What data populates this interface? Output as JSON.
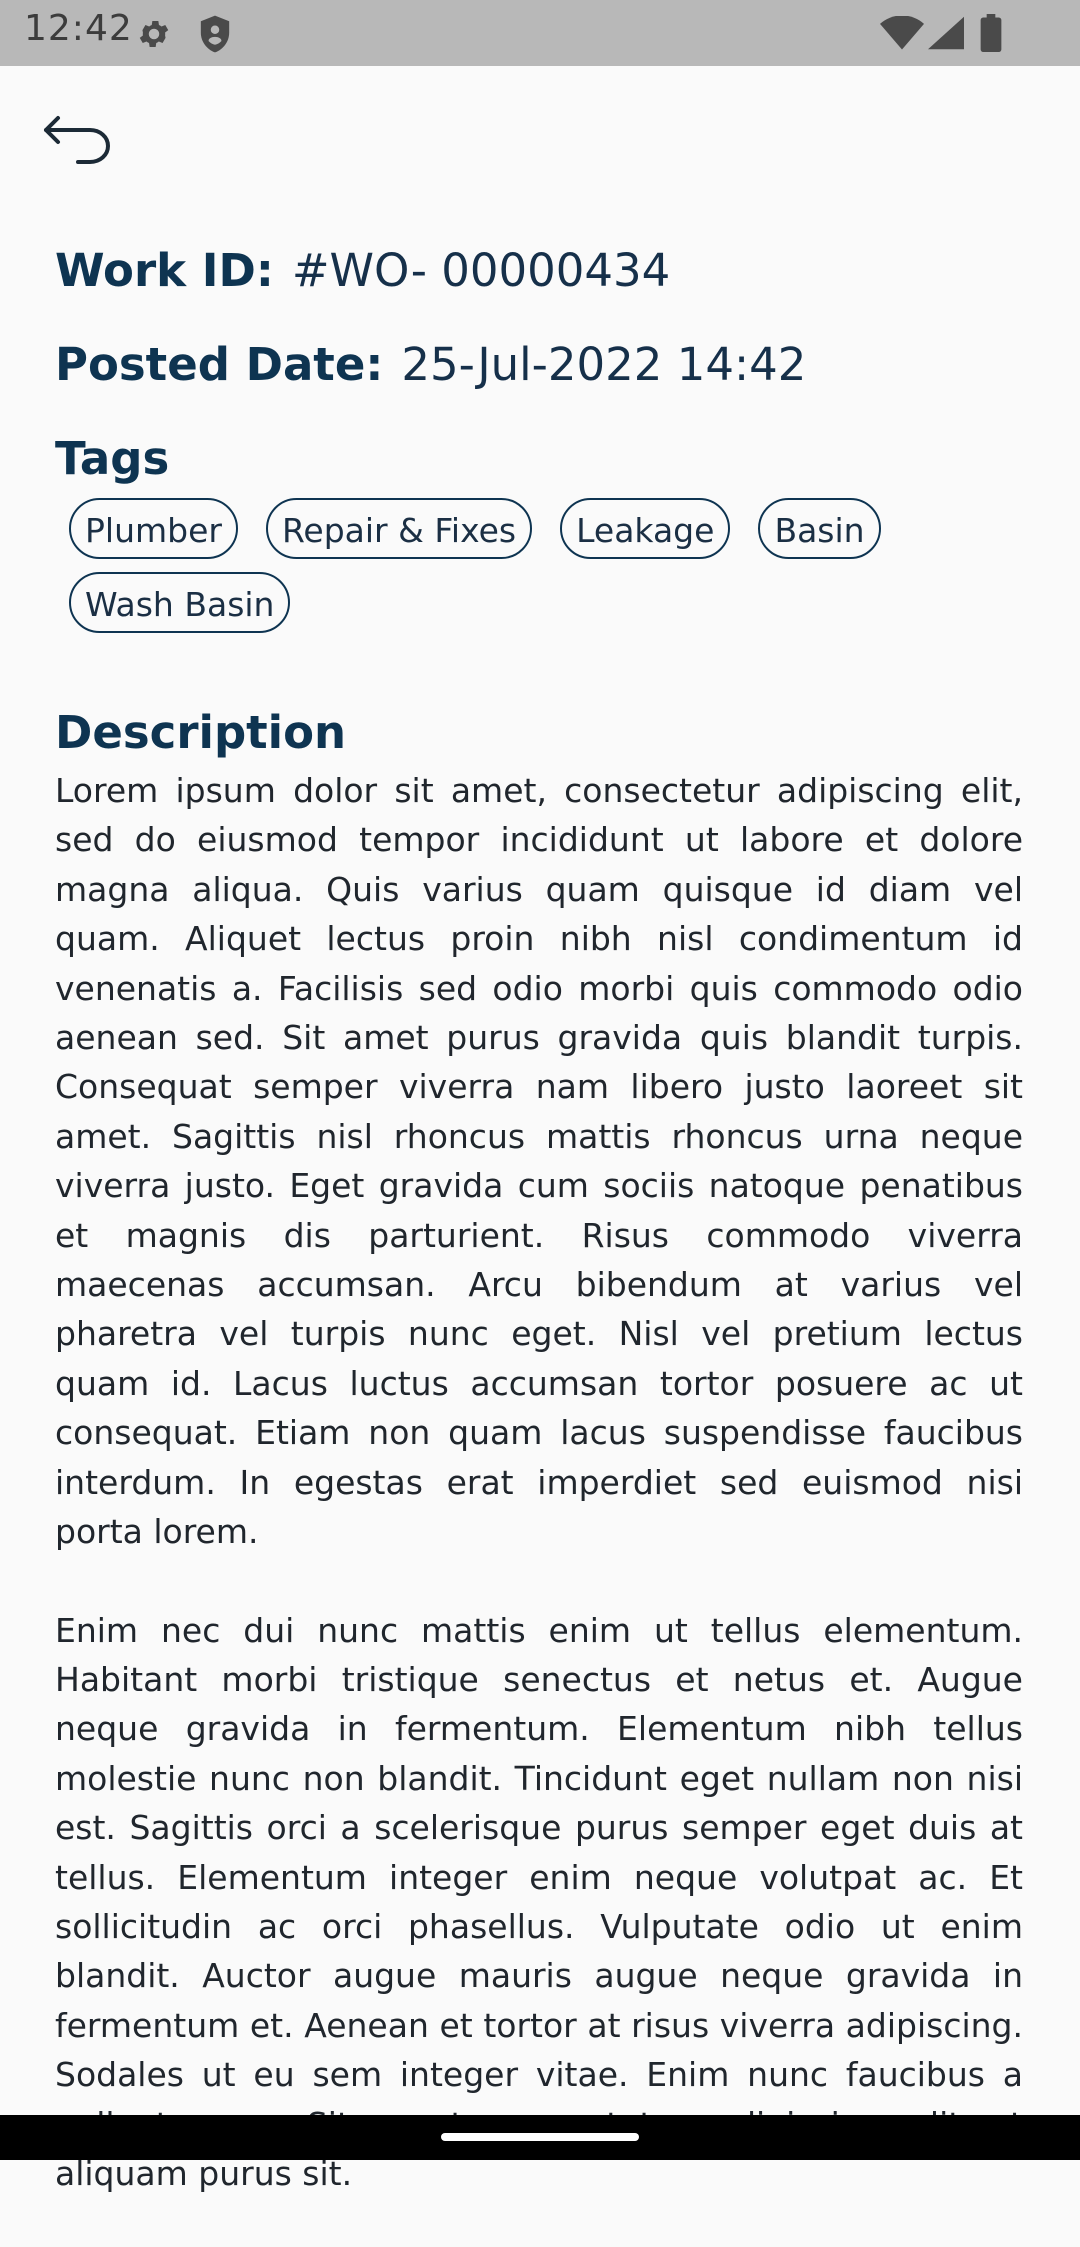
{
  "status_bar": {
    "time": "12:42",
    "icons": [
      "gear-icon",
      "shield-icon",
      "wifi-icon",
      "signal-icon",
      "battery-icon"
    ]
  },
  "header": {
    "back_icon": "back-arrow-icon"
  },
  "work": {
    "id_label": "Work ID:",
    "id_value": "#WO- 00000434",
    "posted_label": "Posted Date:",
    "posted_value": "25-Jul-2022 14:42"
  },
  "tags": {
    "title": "Tags",
    "items": [
      "Plumber",
      "Repair & Fixes",
      "Leakage",
      "Basin",
      "Wash Basin"
    ]
  },
  "description": {
    "title": "Description",
    "paragraphs": [
      "Lorem ipsum dolor sit amet, consectetur adipiscing elit, sed do eiusmod tempor incididunt ut labore et dolore magna aliqua. Quis varius quam quisque id diam vel quam. Aliquet lectus proin nibh nisl condimentum id venenatis a. Facilisis sed odio morbi quis commodo odio aenean sed. Sit amet purus gravida quis blandit turpis. Consequat semper viverra nam libero justo laoreet sit amet. Sagittis nisl rhoncus mattis rhoncus urna neque viverra justo. Eget gravida cum sociis natoque penatibus et magnis dis parturient. Risus commodo viverra maecenas accumsan. Arcu bibendum at varius vel pharetra vel turpis nunc eget. Nisl vel pretium lectus quam id. Lacus luctus accumsan tortor posuere ac ut consequat. Etiam non quam lacus suspendisse faucibus interdum. In egestas erat imperdiet sed euismod nisi porta lorem.",
      "Enim nec dui nunc mattis enim ut tellus elementum. Habitant morbi tristique senectus et netus et. Augue neque gravida in fermentum. Elementum nibh tellus molestie nunc non blandit. Tincidunt eget nullam non nisi est. Sagittis orci a scelerisque purus semper eget duis at tellus. Elementum integer enim neque volutpat ac. Et sollicitudin ac orci phasellus. Vulputate odio ut enim blandit. Auctor augue mauris augue neque gravida in fermentum et. Aenean et tortor at risus viverra adipiscing. Sodales ut eu sem integer vitae. Enim nunc faucibus a pellentesque. Sit amet consectetur adipiscing elit ut aliquam purus sit."
    ]
  }
}
